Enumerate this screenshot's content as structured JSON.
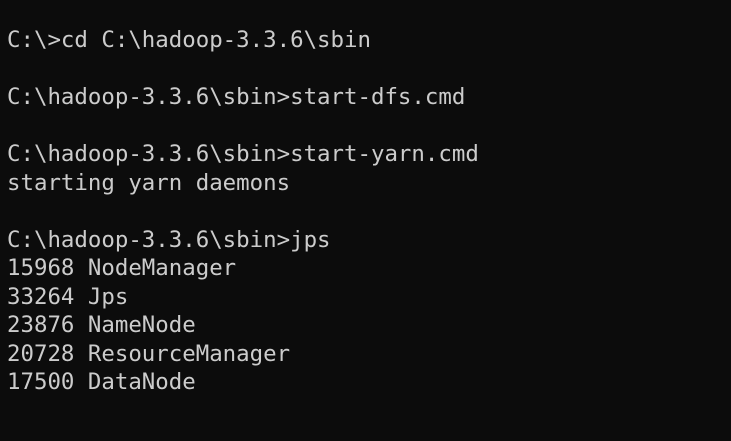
{
  "terminal": {
    "lines": [
      "C:\\>cd C:\\hadoop-3.3.6\\sbin",
      "",
      "C:\\hadoop-3.3.6\\sbin>start-dfs.cmd",
      "",
      "C:\\hadoop-3.3.6\\sbin>start-yarn.cmd",
      "starting yarn daemons",
      "",
      "C:\\hadoop-3.3.6\\sbin>jps",
      "15968 NodeManager",
      "33264 Jps",
      "23876 NameNode",
      "20728 ResourceManager",
      "17500 DataNode"
    ],
    "background_color": "#0c0c0c",
    "text_color": "#cccccc"
  }
}
